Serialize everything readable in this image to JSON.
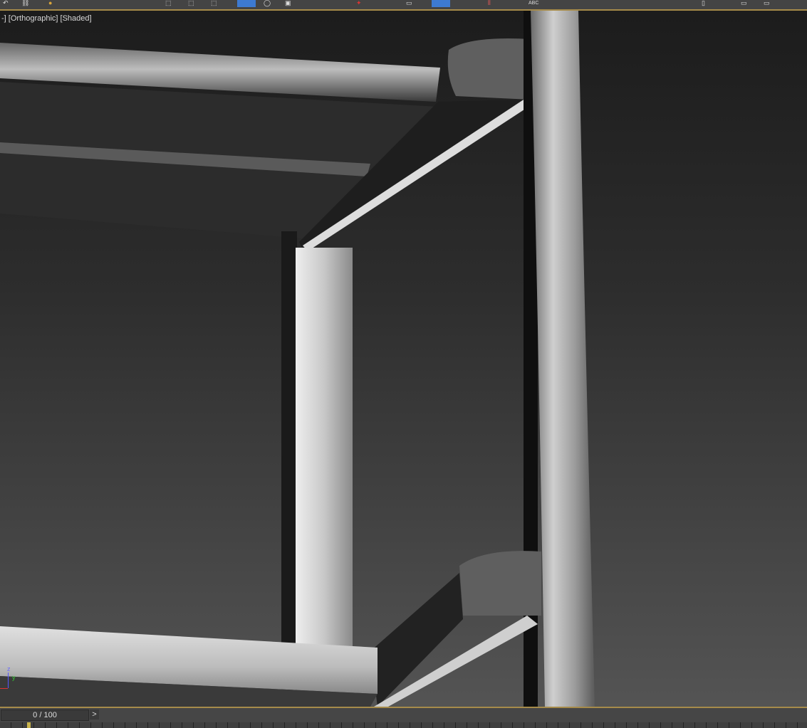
{
  "toolbar": {
    "abc_label": "ABC",
    "accent": "#3d7ad1"
  },
  "viewport": {
    "label": "[+] [Orthographic] [Shaded]",
    "label_visible": "-] [Orthographic] [Shaded]"
  },
  "axis": {
    "z": "z",
    "y": "y"
  },
  "timeline": {
    "frame": "0 / 100",
    "next_label": ">"
  }
}
